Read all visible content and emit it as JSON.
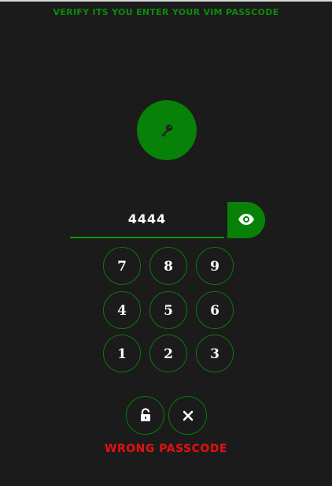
{
  "header": {
    "title": "VERIFY ITS YOU ENTER YOUR VIM PASSCODE"
  },
  "passcode": {
    "value": "4444",
    "visibility_icon": "eye-icon"
  },
  "key_icon": "key-icon",
  "keypad": {
    "rows": [
      [
        "7",
        "8",
        "9"
      ],
      [
        "4",
        "5",
        "6"
      ],
      [
        "1",
        "2",
        "3"
      ]
    ]
  },
  "actions": {
    "unlock_icon": "unlock-icon",
    "clear_icon": "close-icon"
  },
  "status": {
    "error": "WRONG PASSCODE"
  },
  "colors": {
    "accent": "#078107",
    "error": "#e61010",
    "background": "#1b1b1b"
  }
}
